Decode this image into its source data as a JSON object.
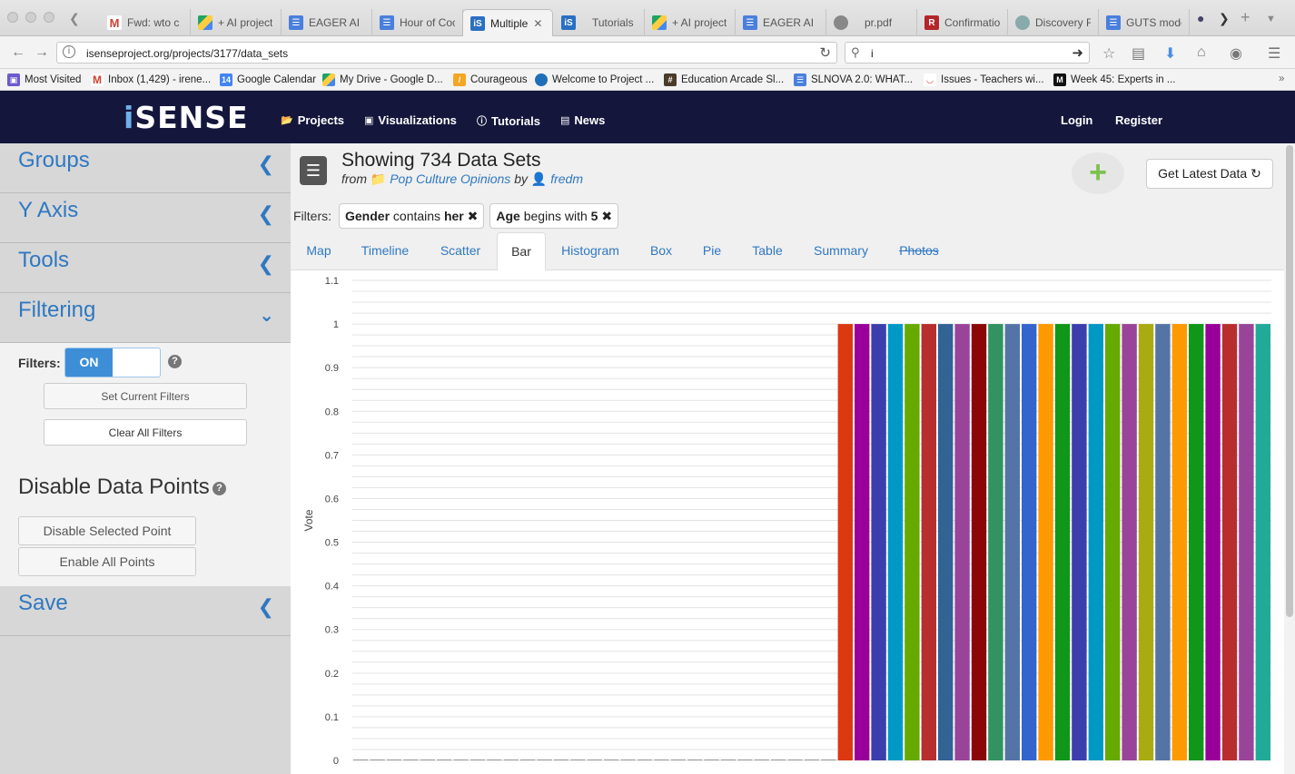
{
  "browser": {
    "tabs": [
      {
        "title": "Fwd: wto c",
        "icon": "gmail-icon"
      },
      {
        "title": "+ AI project",
        "icon": "drive-icon"
      },
      {
        "title": "EAGER AI",
        "icon": "doc-icon"
      },
      {
        "title": "Hour of Coc",
        "icon": "doc-icon"
      },
      {
        "title": "Multiple",
        "icon": "isense-icon",
        "active": true
      },
      {
        "title": "Tutorials",
        "icon": "isense-icon"
      },
      {
        "title": "+ AI project",
        "icon": "drive-icon"
      },
      {
        "title": "EAGER AI",
        "icon": "doc-icon"
      },
      {
        "title": "pr.pdf",
        "icon": "gear-icon"
      },
      {
        "title": "Confirmatio",
        "icon": "r-icon"
      },
      {
        "title": "Discovery R",
        "icon": "globe-icon"
      },
      {
        "title": "GUTS mode",
        "icon": "doc-icon"
      }
    ],
    "url": "isenseproject.org/projects/3177/data_sets",
    "search_value": "i",
    "bookmarks": [
      "Most Visited",
      "Inbox (1,429) - irene...",
      "Google Calendar",
      "My Drive - Google D...",
      "Courageous",
      "Welcome to Project ...",
      "Education Arcade Sl...",
      "SLNOVA 2.0: WHAT...",
      "Issues - Teachers wi...",
      "Week 45: Experts in ..."
    ]
  },
  "site": {
    "logo": "iSENSE",
    "nav": [
      {
        "label": "Projects",
        "icon": "folder-icon"
      },
      {
        "label": "Visualizations",
        "icon": "picture-icon"
      },
      {
        "label": "Tutorials",
        "icon": "info-icon"
      },
      {
        "label": "News",
        "icon": "newspaper-icon"
      }
    ],
    "login": "Login",
    "register": "Register"
  },
  "sidebar": {
    "groups": "Groups",
    "y_axis": "Y Axis",
    "tools": "Tools",
    "filtering": "Filtering",
    "filters_label": "Filters:",
    "toggle_on": "ON",
    "set_current": "Set Current Filters",
    "clear_all": "Clear All Filters",
    "disable_title": "Disable Data Points",
    "disable_selected": "Disable Selected Point",
    "enable_all": "Enable All Points",
    "save": "Save"
  },
  "main": {
    "title": "Showing 734 Data Sets",
    "from_word": "from",
    "project": "Pop Culture Opinions",
    "by_word": "by",
    "owner": "fredm",
    "get_latest": "Get Latest Data",
    "filters_label": "Filters:",
    "filter_chips": [
      {
        "field": "Gender",
        "op": "contains",
        "value": "her"
      },
      {
        "field": "Age",
        "op": "begins with",
        "value": "5"
      }
    ],
    "tabs": [
      "Map",
      "Timeline",
      "Scatter",
      "Bar",
      "Histogram",
      "Box",
      "Pie",
      "Table",
      "Summary",
      "Photos"
    ],
    "active_tab": "Bar"
  },
  "chart_data": {
    "type": "bar",
    "ylabel": "Vote",
    "ylim": [
      0,
      1.1
    ],
    "y_ticks": [
      "0",
      "0.1",
      "0.2",
      "0.3",
      "0.4",
      "0.5",
      "0.6",
      "0.7",
      "0.8",
      "0.9",
      "1",
      "1.1"
    ],
    "values": [
      0,
      0,
      0,
      0,
      0,
      0,
      0,
      0,
      0,
      0,
      0,
      0,
      0,
      0,
      0,
      0,
      0,
      0,
      0,
      0,
      0,
      0,
      0,
      0,
      0,
      0,
      0,
      0,
      0,
      1,
      1,
      1,
      1,
      1,
      1,
      1,
      1,
      1,
      1,
      1,
      1,
      1,
      1,
      1,
      1,
      1,
      1,
      1,
      1,
      1,
      1,
      1,
      1,
      1,
      1
    ],
    "colors": [
      "#dc3912",
      "#990099",
      "#3b3eac",
      "#0099c6",
      "#66aa00",
      "#b82e2e",
      "#316395",
      "#994499",
      "#8b0707",
      "#329262",
      "#5574a6",
      "#3366cc",
      "#ff9900",
      "#109618",
      "#3b3eac",
      "#0099c6",
      "#66aa00",
      "#994499",
      "#aaaa11",
      "#5574a6",
      "#ff9900",
      "#109618",
      "#990099",
      "#b82e2e",
      "#994499",
      "#22aa99"
    ]
  }
}
